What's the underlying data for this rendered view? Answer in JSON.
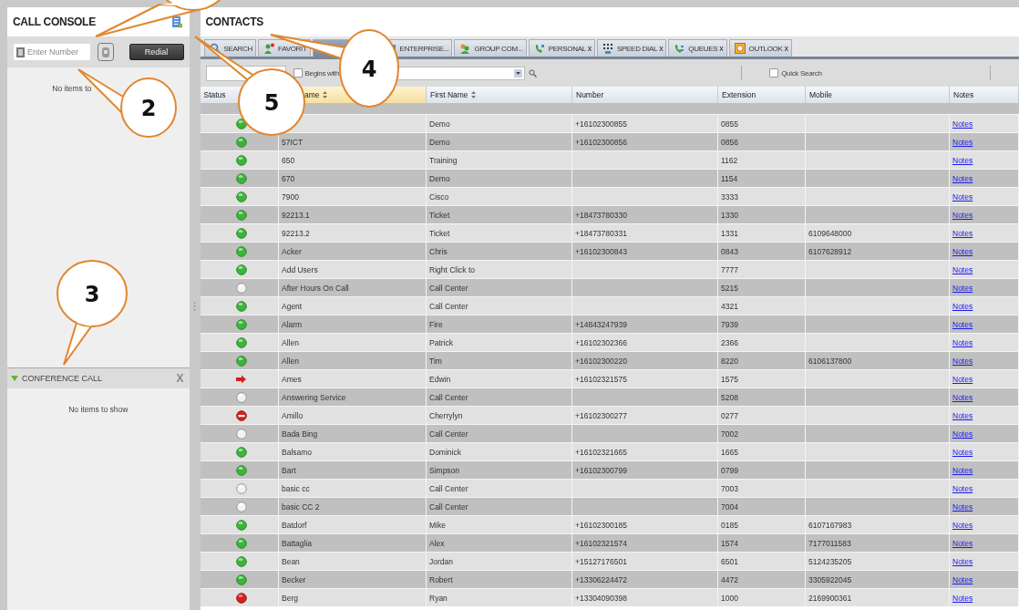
{
  "call_console": {
    "title": "CALL CONSOLE",
    "number_field": {
      "placeholder": "Enter Number"
    },
    "redial_button": "Redial",
    "empty_text": "No items to"
  },
  "conference_call": {
    "title": "CONFERENCE CALL",
    "expanded": true,
    "close": "X",
    "empty_text": "No items to show"
  },
  "contacts": {
    "title": "CONTACTS",
    "tabs": [
      {
        "label": "SEARCH",
        "selected": false
      },
      {
        "label": "FAVORIT",
        "selected": false
      },
      {
        "selected": true
      },
      {
        "label": "ENTERPRISE...",
        "selected": false
      },
      {
        "label": "GROUP COM...",
        "selected": false
      },
      {
        "label": "PERSONAL",
        "close": "x",
        "selected": false
      },
      {
        "label": "SPEED DIAL",
        "close": "x",
        "selected": false
      },
      {
        "label": "QUEUES",
        "close": "x",
        "selected": false
      },
      {
        "label": "OUTLOOK",
        "close": "x",
        "selected": false
      }
    ],
    "filter": {
      "begins_with": {
        "label": "Begins with",
        "checked": false
      },
      "quick_search": {
        "label": "Quick Search",
        "checked": false
      }
    },
    "columns": [
      {
        "label": "Status",
        "sortable": false
      },
      {
        "label": "ame",
        "sortable": true
      },
      {
        "label": "First Name",
        "sortable": true
      },
      {
        "label": "Number",
        "sortable": false
      },
      {
        "label": "Extension",
        "sortable": false
      },
      {
        "label": "Mobile",
        "sortable": false
      },
      {
        "label": "Notes",
        "sortable": false
      }
    ],
    "rows": [
      {
        "kind": "available",
        "first_name": "Demo",
        "number": "+16102300855",
        "extension": "0855",
        "notes": "Notes"
      },
      {
        "kind": "available",
        "last_name": "57ICT",
        "first_name": "Demo",
        "number": "+16102300856",
        "extension": "0856",
        "notes": "Notes"
      },
      {
        "kind": "available",
        "last_name": "650",
        "first_name": "Training",
        "extension": "1162",
        "notes": "Notes"
      },
      {
        "kind": "available",
        "last_name": "670",
        "first_name": "Demo",
        "extension": "1154",
        "notes": "Notes"
      },
      {
        "kind": "available",
        "last_name": "7900",
        "first_name": "Cisco",
        "extension": "3333",
        "notes": "Notes"
      },
      {
        "kind": "available",
        "last_name": "92213.1",
        "first_name": "Ticket",
        "number": "+18473780330",
        "extension": "1330",
        "notes": "Notes"
      },
      {
        "kind": "available",
        "last_name": "92213.2",
        "first_name": "Ticket",
        "number": "+18473780331",
        "extension": "1331",
        "mobile": "6109648000",
        "notes": "Notes"
      },
      {
        "kind": "available",
        "last_name": "Acker",
        "first_name": "Chris",
        "number": "+16102300843",
        "extension": "0843",
        "mobile": "6107628912",
        "notes": "Notes"
      },
      {
        "kind": "available",
        "last_name": "Add Users",
        "first_name": "Right Click to",
        "extension": "7777",
        "notes": "Notes"
      },
      {
        "kind": "offline",
        "last_name": "After Hours On Call",
        "first_name": "Call Center",
        "extension": "5215",
        "notes": "Notes"
      },
      {
        "kind": "available",
        "last_name": "Agent",
        "first_name": "Call Center",
        "extension": "4321",
        "notes": "Notes"
      },
      {
        "kind": "available",
        "last_name": "Alarm",
        "first_name": "Fire",
        "number": "+14843247939",
        "extension": "7939",
        "notes": "Notes"
      },
      {
        "kind": "available",
        "last_name": "Allen",
        "first_name": "Patrick",
        "number": "+16102302366",
        "extension": "2366",
        "notes": "Notes"
      },
      {
        "kind": "available",
        "last_name": "Allen",
        "first_name": "Tim",
        "number": "+16102300220",
        "extension": "8220",
        "mobile": "6106137800",
        "notes": "Notes"
      },
      {
        "kind": "forwarded",
        "last_name": "Ames",
        "first_name": "Edwin",
        "number": "+16102321575",
        "extension": "1575",
        "notes": "Notes"
      },
      {
        "kind": "offline",
        "last_name": "Answering Service",
        "first_name": "Call Center",
        "extension": "5208",
        "notes": "Notes"
      },
      {
        "kind": "dnd",
        "last_name": "Amillo",
        "first_name": "Cherrylyn",
        "number": "+16102300277",
        "extension": "0277",
        "notes": "Notes"
      },
      {
        "kind": "offline",
        "last_name": "Bada Bing",
        "first_name": "Call Center",
        "extension": "7002",
        "notes": "Notes"
      },
      {
        "kind": "available",
        "last_name": "Balsamo",
        "first_name": "Dominick",
        "number": "+16102321665",
        "extension": "1665",
        "notes": "Notes"
      },
      {
        "kind": "available",
        "last_name": "Bart",
        "first_name": "Simpson",
        "number": "+16102300799",
        "extension": "0799",
        "notes": "Notes"
      },
      {
        "kind": "offline",
        "last_name": "basic cc",
        "first_name": "Call Center",
        "extension": "7003",
        "notes": "Notes"
      },
      {
        "kind": "offline",
        "last_name": "basic CC 2",
        "first_name": "Call Center",
        "extension": "7004",
        "notes": "Notes"
      },
      {
        "kind": "available",
        "last_name": "Batdorf",
        "first_name": "Mike",
        "number": "+16102300185",
        "extension": "0185",
        "mobile": "6107167983",
        "notes": "Notes"
      },
      {
        "kind": "available",
        "last_name": "Battaglia",
        "first_name": "Alex",
        "number": "+16102321574",
        "extension": "1574",
        "mobile": "7177011583",
        "notes": "Notes"
      },
      {
        "kind": "available",
        "last_name": "Bean",
        "first_name": "Jordan",
        "number": "+15127176501",
        "extension": "6501",
        "mobile": "5124235205",
        "notes": "Notes"
      },
      {
        "kind": "available",
        "last_name": "Becker",
        "first_name": "Robert",
        "number": "+13306224472",
        "extension": "4472",
        "mobile": "3305922045",
        "notes": "Notes"
      },
      {
        "kind": "busy",
        "last_name": "Berg",
        "first_name": "Ryan",
        "number": "+13304090398",
        "extension": "1000",
        "mobile": "2169900361",
        "notes": "Notes"
      }
    ]
  },
  "callouts": [
    {
      "kind": "cut"
    },
    {
      "kind": "full",
      "number": "2"
    },
    {
      "kind": "full",
      "number": "3"
    },
    {
      "kind": "full",
      "number": "4"
    },
    {
      "kind": "full",
      "number": "5"
    }
  ]
}
